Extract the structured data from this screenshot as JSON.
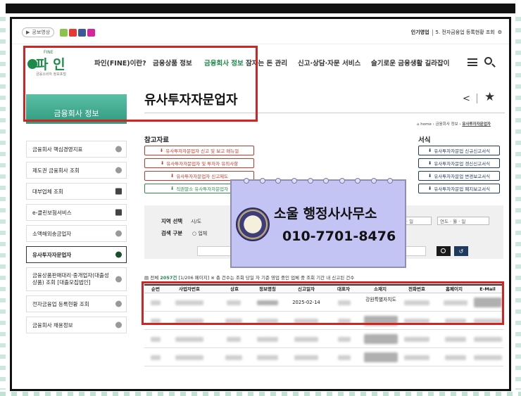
{
  "utility": {
    "home_label": "공보영상",
    "popular_label": "인기영업",
    "popular_item": "5. 전자금융업 등록현황 조회"
  },
  "logo": {
    "small": "FINE",
    "text": "파 인",
    "sub": "금융소비자 정보포털"
  },
  "nav": [
    "파인(FINE)이란?",
    "금융상품 정보",
    "금융회사 정보",
    "잠자는 돈 관리",
    "신고·상담·자문 서비스",
    "슬기로운 금융생활 길라잡이"
  ],
  "sidebar": {
    "title": "금융회사 정보",
    "items": [
      "금융회사 핵심경영지표",
      "제도권 금융회사 조회",
      "대부업체 조회",
      "e-클린보험서비스",
      "소액해외송금업자",
      "유사투자자문업자",
      "금융상품판매대리·중개업자(대출성 상품) 조회 [대출모집법인]",
      "전자금융업 등록현황 조회",
      "금융회사 채용정보"
    ]
  },
  "page_title": "유사투자자문업자",
  "breadcrumb": [
    "home",
    "금융회사 정보",
    "유사투자자문업자"
  ],
  "reference": {
    "label": "참고자료",
    "buttons": [
      "유사투자자문업자 신고 및 보고 매뉴얼",
      "유사투자자문업자 및 투자자 유의사항",
      "유사투자자문업자 신고제도",
      "직권말소 유사투자자문업자"
    ]
  },
  "forms": {
    "label": "서식",
    "buttons": [
      "유사투자자문업 신규신고서식",
      "유사투자자문업 갱신신고서식",
      "유사투자자문업 변경보고서식",
      "유사투자자문업 폐지보고서식"
    ]
  },
  "search": {
    "region_label": "지역 선택",
    "region_sub": "시/도",
    "type_label": "검색 구분",
    "type_option": "업체",
    "date_start_placeholder": "월 · 일",
    "date_end_placeholder": "연도 · 월 · 일",
    "reset_icon": "↺"
  },
  "total": {
    "prefix": "전체",
    "count": "2057건",
    "pages": "[1/206 페이지]",
    "note": "※ 총 건수는 조회 당일 자 기준 영업 중인 업체 중 조회 기간 내 신고된 건수"
  },
  "table": {
    "headers": [
      "순번",
      "사업자번호",
      "상호",
      "정보명칭",
      "신고일자",
      "대표자",
      "소재지",
      "전화번호",
      "홈페이지",
      "E-Mail"
    ],
    "highlight_row": {
      "date": "2025-02-14",
      "address": "강원특별자치도"
    }
  },
  "ad": {
    "name": "소울 행정사사무소",
    "phone": "010-7701-8476"
  },
  "colors": {
    "brand_green": "#1e8a4a",
    "highlight_red": "#d32323",
    "ad_bg": "#c3c4f4"
  }
}
